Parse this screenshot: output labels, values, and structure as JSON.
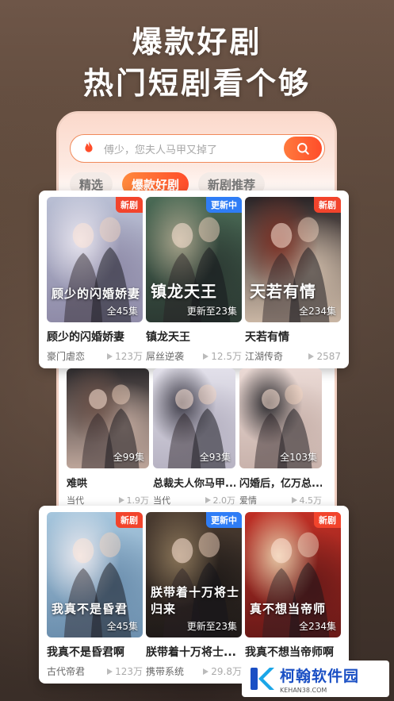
{
  "headline": {
    "line1": "爆款好剧",
    "line2": "热门短剧看个够"
  },
  "search": {
    "placeholder": "傅少，您夫人马甲又掉了"
  },
  "tabs": [
    {
      "label": "精选",
      "active": false
    },
    {
      "label": "爆款好剧",
      "active": true
    },
    {
      "label": "新剧推荐",
      "active": false
    }
  ],
  "row1": [
    {
      "badge": "新剧",
      "badge_color": "#f2442c",
      "eps": "全45集",
      "art": "顾少的闪婚娇妻",
      "title": "顾少的闪婚娇妻",
      "tag": "豪门虐恋",
      "views": "123万",
      "palette": [
        "#b9bfd4",
        "#e7e4ee",
        "#8f8ba8"
      ]
    },
    {
      "badge": "更新中",
      "badge_color": "#2f7df6",
      "eps": "更新至23集",
      "art": "镇龙天王",
      "title": "镇龙天王",
      "tag": "屌丝逆袭",
      "views": "12.5万",
      "palette": [
        "#4a6a55",
        "#a6a28a",
        "#2c3a33"
      ]
    },
    {
      "badge": "新剧",
      "badge_color": "#f2442c",
      "eps": "全234集",
      "art": "天若有情",
      "title": "天若有情",
      "tag": "江湖传奇",
      "views": "2587",
      "palette": [
        "#2a2426",
        "#7b3024",
        "#c9b6a4"
      ]
    }
  ],
  "row2": [
    {
      "eps": "全99集",
      "title": "难哄",
      "tag": "当代",
      "views": "1.9万",
      "palette": [
        "#2d2a2c",
        "#6b5148",
        "#bda59a"
      ]
    },
    {
      "eps": "全93集",
      "title": "总裁夫人你马甲...",
      "tag": "当代",
      "views": "2.0万",
      "palette": [
        "#e2e0ea",
        "#3e3c48",
        "#b7b3c3"
      ]
    },
    {
      "eps": "全103集",
      "title": "闪婚后，亿万总...",
      "tag": "爱情",
      "views": "4.5万",
      "palette": [
        "#ead9d4",
        "#2b2a2e",
        "#c9b3ac"
      ]
    }
  ],
  "row3": [
    {
      "badge": "新剧",
      "badge_color": "#f2442c",
      "eps": "全45集",
      "art": "我真不是昏君",
      "title": "我真不是昏君啊",
      "tag": "古代帝君",
      "views": "123万",
      "palette": [
        "#a6c6dd",
        "#e9e9ef",
        "#6c8fae"
      ]
    },
    {
      "badge": "更新中",
      "badge_color": "#2f7df6",
      "eps": "更新至23集",
      "art": "朕带着十万将士归来",
      "title": "朕带着十万将士...",
      "tag": "携带系统",
      "views": "29.8万",
      "palette": [
        "#4a3b30",
        "#8a7559",
        "#1f1a18"
      ]
    },
    {
      "badge": "新剧",
      "badge_color": "#f2442c",
      "eps": "全234集",
      "art": "真不想当帝师",
      "title": "我真不想当帝师啊",
      "tag": "",
      "views": "",
      "palette": [
        "#c02f25",
        "#e7c9a6",
        "#6a1a18"
      ]
    }
  ],
  "watermark": {
    "main": "柯翰软件园",
    "sub": "KEHAN38.COM"
  },
  "colors": {
    "accent": "#ff5a2a",
    "badge_new": "#f2442c",
    "badge_updating": "#2f7df6"
  }
}
